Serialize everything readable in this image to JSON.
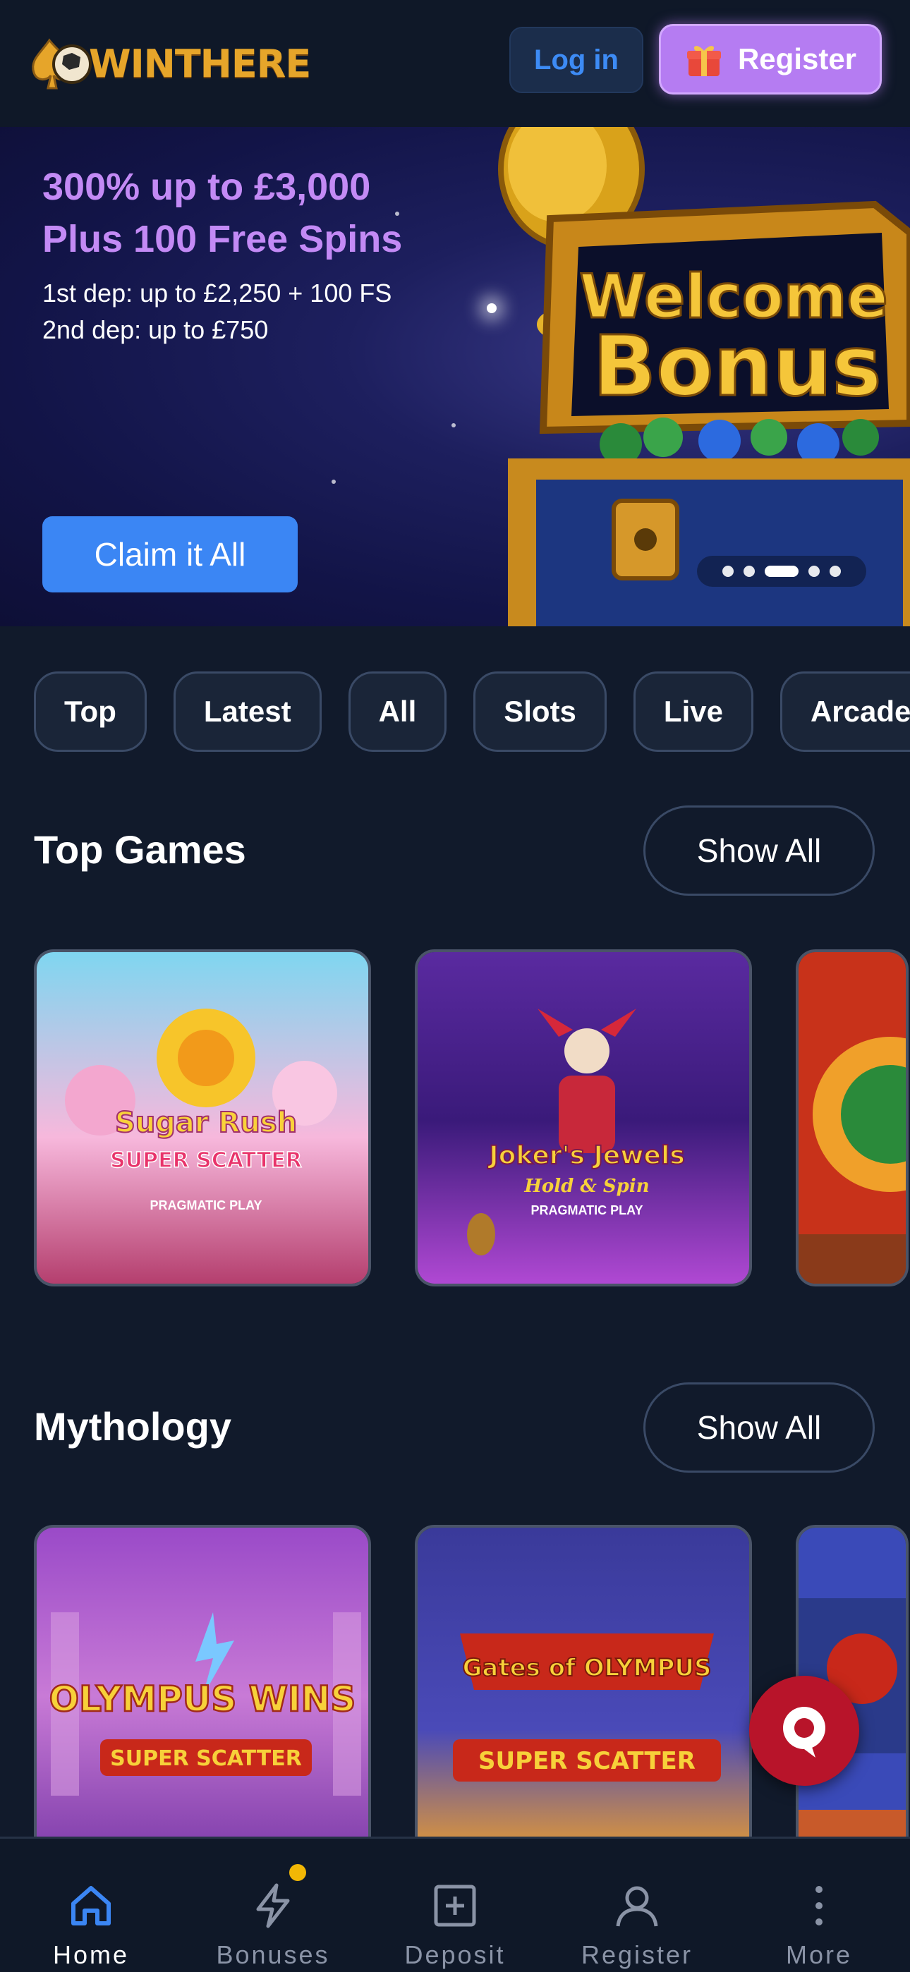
{
  "header": {
    "logo_text": "WINTHERE",
    "login_label": "Log in",
    "register_label": "Register"
  },
  "hero": {
    "title_line1": "300% up to £3,000",
    "title_line2": "Plus 100 Free Spins",
    "sub_line1": "1st dep: up to £2,250 + 100 FS",
    "sub_line2": "2nd dep: up to £750",
    "cta_label": "Claim it All",
    "art_text_line1": "Welcome",
    "art_text_line2": "Bonus",
    "carousel": {
      "slides": 5,
      "active": 3
    }
  },
  "categories": [
    "Top",
    "Latest",
    "All",
    "Slots",
    "Live",
    "Arcade"
  ],
  "sections": [
    {
      "title": "Top Games",
      "show_all": "Show All",
      "games": [
        {
          "name_line1": "Sugar Rush",
          "name_line2": "SUPER SCATTER",
          "provider": "PRAGMATIC PLAY"
        },
        {
          "name_line1": "Joker's Jewels",
          "name_line2": "Hold & Spin",
          "provider": "PRAGMATIC PLAY"
        }
      ]
    },
    {
      "title": "Mythology",
      "show_all": "Show All",
      "games": [
        {
          "name_line1": "OLYMPUS WINS",
          "name_line2": "SUPER SCATTER"
        },
        {
          "name_line1": "Gates of OLYMPUS",
          "name_line2": "SUPER SCATTER"
        }
      ]
    }
  ],
  "bottom_nav": [
    {
      "label": "Home",
      "icon": "home-icon",
      "active": true
    },
    {
      "label": "Bonuses",
      "icon": "lightning-icon",
      "active": false
    },
    {
      "label": "Deposit",
      "icon": "plus-square-icon",
      "active": false
    },
    {
      "label": "Register",
      "icon": "user-icon",
      "active": false
    },
    {
      "label": "More",
      "icon": "more-vertical-icon",
      "active": false
    }
  ],
  "colors": {
    "background": "#111a2b",
    "accent_blue": "#3b86f4",
    "accent_purple": "#b57cf2",
    "hero_title": "#c38af5",
    "badge": "#f2b705",
    "chat": "#b8142a"
  }
}
